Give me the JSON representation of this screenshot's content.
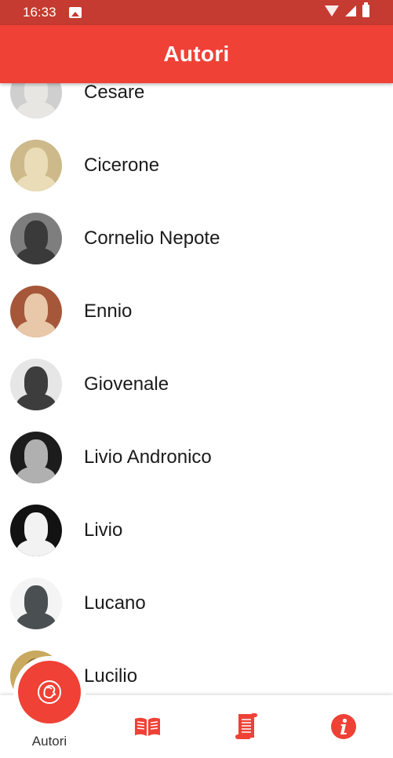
{
  "status_bar": {
    "time": "16:33"
  },
  "app_bar": {
    "title": "Autori"
  },
  "authors": [
    {
      "name": "Cesare",
      "avatar_bg": "#cfcfcf",
      "avatar_fg": "#e8e6e3"
    },
    {
      "name": "Cicerone",
      "avatar_bg": "#cdb98a",
      "avatar_fg": "#e9dcb7"
    },
    {
      "name": "Cornelio Nepote",
      "avatar_bg": "#7e7e7e",
      "avatar_fg": "#3a3a3a"
    },
    {
      "name": "Ennio",
      "avatar_bg": "#a6573a",
      "avatar_fg": "#e8c8a8"
    },
    {
      "name": "Giovenale",
      "avatar_bg": "#e6e6e6",
      "avatar_fg": "#3d3d3d"
    },
    {
      "name": "Livio Andronico",
      "avatar_bg": "#1c1c1c",
      "avatar_fg": "#b0b0b0"
    },
    {
      "name": "Livio",
      "avatar_bg": "#121212",
      "avatar_fg": "#f2f2f2"
    },
    {
      "name": "Lucano",
      "avatar_bg": "#f4f4f4",
      "avatar_fg": "#4a4f52"
    },
    {
      "name": "Lucilio",
      "avatar_bg": "#c9a860",
      "avatar_fg": "#8a6a2a"
    }
  ],
  "bottom_nav": {
    "active_label": "Autori",
    "items": [
      {
        "icon": "author-head-icon",
        "label": "Autori"
      },
      {
        "icon": "open-book-icon"
      },
      {
        "icon": "scroll-document-icon"
      },
      {
        "icon": "info-icon"
      }
    ]
  },
  "colors": {
    "primary": "#ef4136",
    "status_bar": "#c53a31",
    "text": "#1b1b1b"
  }
}
